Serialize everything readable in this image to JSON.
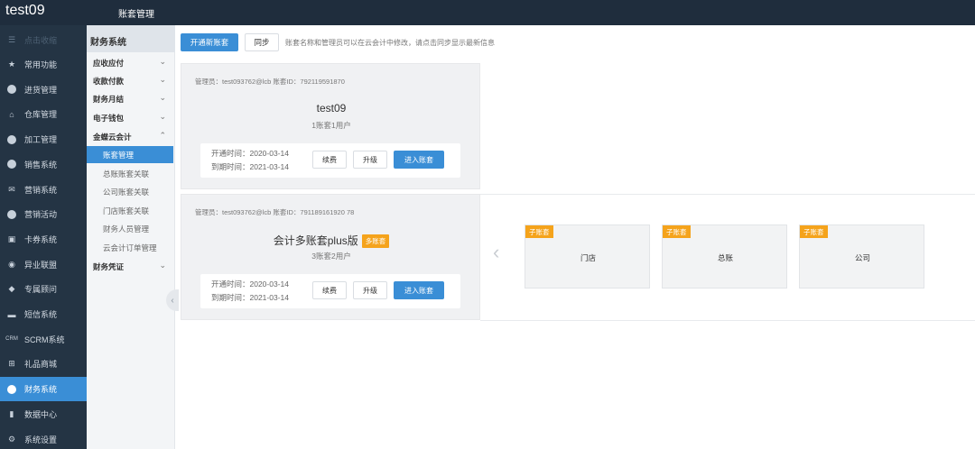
{
  "header": {
    "brand": "test09",
    "page_title": "账套管理"
  },
  "nav": {
    "collapse_label": "点击收缩",
    "items": [
      {
        "label": "常用功能",
        "icon": "star-icon"
      },
      {
        "label": "进货管理",
        "icon": "purchase-icon"
      },
      {
        "label": "仓库管理",
        "icon": "warehouse-icon"
      },
      {
        "label": "加工管理",
        "icon": "process-icon"
      },
      {
        "label": "销售系统",
        "icon": "sales-icon"
      },
      {
        "label": "营销系统",
        "icon": "chat-icon"
      },
      {
        "label": "营销活动",
        "icon": "activity-icon"
      },
      {
        "label": "卡券系统",
        "icon": "card-icon"
      },
      {
        "label": "异业联盟",
        "icon": "alliance-icon"
      },
      {
        "label": "专属顾问",
        "icon": "advisor-icon"
      },
      {
        "label": "短信系统",
        "icon": "sms-icon"
      },
      {
        "label": "SCRM系统",
        "icon": "scrm-icon",
        "icon_text": "CRM"
      },
      {
        "label": "礼品商城",
        "icon": "gift-icon"
      },
      {
        "label": "财务系统",
        "icon": "finance-icon",
        "active": true
      },
      {
        "label": "数据中心",
        "icon": "chart-icon"
      },
      {
        "label": "系统设置",
        "icon": "settings-icon"
      }
    ]
  },
  "submenu": {
    "title": "财务系统",
    "items": [
      {
        "label": "应收应付",
        "type": "group",
        "expanded": false
      },
      {
        "label": "收款付款",
        "type": "group",
        "expanded": false
      },
      {
        "label": "财务月结",
        "type": "group",
        "expanded": false
      },
      {
        "label": "电子钱包",
        "type": "group",
        "expanded": false
      },
      {
        "label": "金蝶云会计",
        "type": "group",
        "expanded": true
      },
      {
        "label": "账套管理",
        "type": "child",
        "active": true
      },
      {
        "label": "总账账套关联",
        "type": "child"
      },
      {
        "label": "公司账套关联",
        "type": "child"
      },
      {
        "label": "门店账套关联",
        "type": "child"
      },
      {
        "label": "财务人员管理",
        "type": "child"
      },
      {
        "label": "云会计订单管理",
        "type": "child"
      },
      {
        "label": "财务凭证",
        "type": "group",
        "expanded": false
      }
    ]
  },
  "toolbar": {
    "open_account_label": "开通新账套",
    "sync_label": "同步",
    "hint": "账套名称和管理员可以在云会计中修改，请点击同步显示最新信息"
  },
  "accounts": [
    {
      "admin": "管理员：test093762@lcb   账套ID：792119591870",
      "name": "test09",
      "badge": "",
      "meta": "1账套1用户",
      "open_time": "开通时间：2020-03-14",
      "expire_time": "到期时间：2021-03-14",
      "renew_label": "续费",
      "upgrade_label": "升级",
      "enter_label": "进入账套",
      "sub_accounts": []
    },
    {
      "admin": "管理员：test093762@lcb   账套ID：791189161920 78",
      "name": "会计多账套plus版",
      "badge": "多账套",
      "meta": "3账套2用户",
      "open_time": "开通时间：2020-03-14",
      "expire_time": "到期时间：2021-03-14",
      "renew_label": "续费",
      "upgrade_label": "升级",
      "enter_label": "进入账套",
      "sub_accounts": [
        {
          "tag": "子账套",
          "name": "门店"
        },
        {
          "tag": "子账套",
          "name": "总账"
        },
        {
          "tag": "子账套",
          "name": "公司"
        }
      ]
    }
  ],
  "colors": {
    "topbar": "#1f2d3d",
    "nav": "#243444",
    "accent": "#3a8ed6",
    "badge": "#f5a31b"
  }
}
